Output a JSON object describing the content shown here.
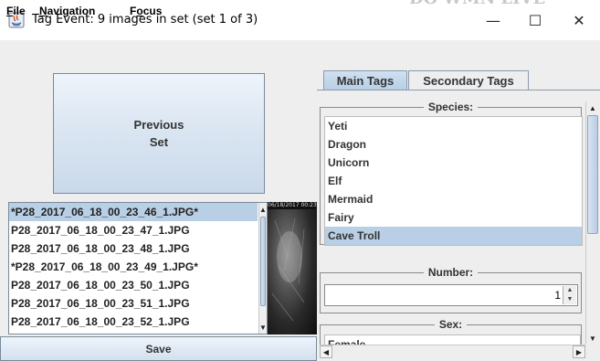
{
  "window": {
    "title": "Tag Event: 9 images in set (set 1 of 3)",
    "minimize_glyph": "—",
    "maximize_glyph": "☐",
    "close_glyph": "✕",
    "background_text": "DO WMN LIVE"
  },
  "menubar": {
    "file": {
      "mnemonic": "F",
      "rest": "ile"
    },
    "navigation": {
      "mnemonic": "N",
      "rest": "avigation"
    },
    "focus": {
      "pre": "F",
      "mnemonic": "o",
      "rest": "cus"
    }
  },
  "previous_set_button": {
    "line1": "Previous",
    "line2": "Set"
  },
  "file_list": {
    "items": [
      {
        "name": "*P28_2017_06_18_00_23_46_1.JPG*",
        "selected": true
      },
      {
        "name": "P28_2017_06_18_00_23_47_1.JPG",
        "selected": false
      },
      {
        "name": "P28_2017_06_18_00_23_48_1.JPG",
        "selected": false
      },
      {
        "name": "*P28_2017_06_18_00_23_49_1.JPG*",
        "selected": false
      },
      {
        "name": "P28_2017_06_18_00_23_50_1.JPG",
        "selected": false
      },
      {
        "name": "P28_2017_06_18_00_23_51_1.JPG",
        "selected": false
      },
      {
        "name": "P28_2017_06_18_00_23_52_1.JPG",
        "selected": false
      }
    ]
  },
  "photo": {
    "stamp": "06/18/2017 00:23"
  },
  "save_button": {
    "label": "Save"
  },
  "tabs": [
    {
      "label": "Main Tags",
      "active": true
    },
    {
      "label": "Secondary Tags",
      "active": false
    }
  ],
  "species": {
    "title": "Species:",
    "items": [
      {
        "label": "Yeti",
        "selected": false
      },
      {
        "label": "Dragon",
        "selected": false
      },
      {
        "label": "Unicorn",
        "selected": false
      },
      {
        "label": "Elf",
        "selected": false
      },
      {
        "label": "Mermaid",
        "selected": false
      },
      {
        "label": "Fairy",
        "selected": false
      },
      {
        "label": "Cave Troll",
        "selected": true
      }
    ]
  },
  "number": {
    "title": "Number:",
    "value": "1",
    "up_glyph": "▲",
    "down_glyph": "▼"
  },
  "sex": {
    "title": "Sex:",
    "first_option": "Female"
  },
  "colors": {
    "selection": "#b8cfe5",
    "panel": "#eeeeee",
    "border": "#7a8a99"
  }
}
